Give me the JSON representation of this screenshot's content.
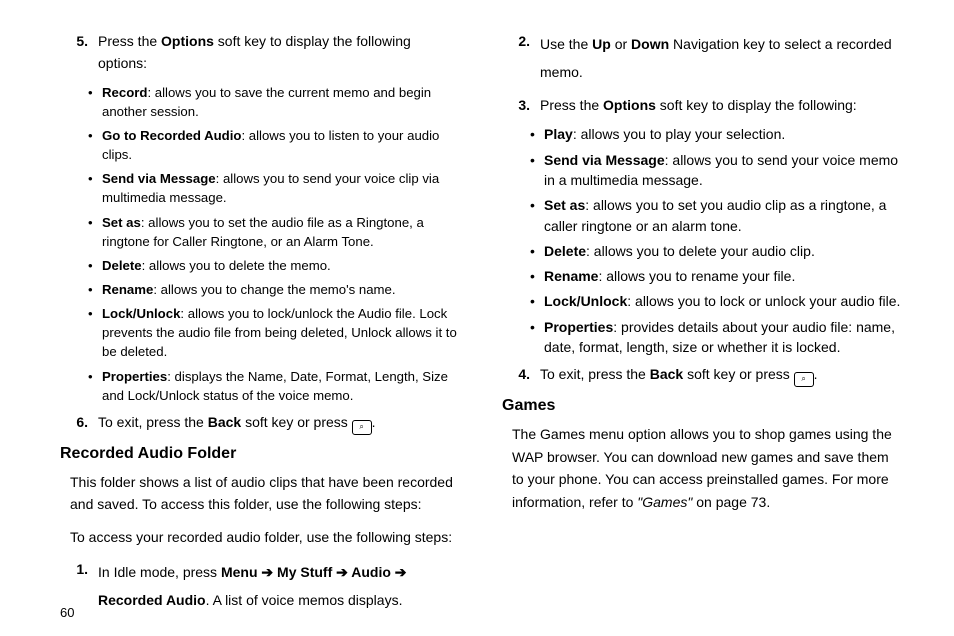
{
  "page_number": "60",
  "left": {
    "step5": {
      "num": "5.",
      "pre": "Press the ",
      "b1": "Options",
      "post": " soft key to display the following options:",
      "bullets": [
        {
          "b": "Record",
          "t": ": allows you to save the current memo and begin another session."
        },
        {
          "b": "Go to Recorded Audio",
          "t": ": allows you to listen to your audio clips."
        },
        {
          "b": "Send via Message",
          "t": ": allows you to send your voice clip via multimedia message."
        },
        {
          "b": "Set as",
          "t": ": allows you to set the audio file as a Ringtone, a ringtone for Caller Ringtone, or an Alarm Tone."
        },
        {
          "b": "Delete",
          "t": ": allows you to delete the memo."
        },
        {
          "b": "Rename",
          "t": ": allows you to change the memo's name."
        },
        {
          "b": "Lock/Unlock",
          "t": ": allows you to lock/unlock the Audio file. Lock prevents the audio file from being deleted, Unlock allows it to be deleted."
        },
        {
          "b": "Properties",
          "t": ": displays the Name, Date, Format, Length, Size and Lock/Unlock status of the voice memo."
        }
      ]
    },
    "step6": {
      "num": "6.",
      "pre": "To exit, press the ",
      "b1": "Back",
      "mid": " soft key or press ",
      "post": "."
    },
    "h_recorded": "Recorded Audio Folder",
    "para1": "This folder shows a list of audio clips that have been recorded and saved. To access this folder, use the following steps:",
    "para2": "To access your recorded audio folder, use the following steps:",
    "step1": {
      "num": "1.",
      "pre": "In Idle mode, press ",
      "b1": "Menu",
      "a1": " ➔ ",
      "b2": "My Stuff",
      "a2": " ➔ ",
      "b3": "Audio",
      "a3": " ➔ ",
      "b4": "Recorded Audio",
      "post": ". A list of voice memos displays."
    }
  },
  "right": {
    "step2": {
      "num": "2.",
      "pre": "Use the ",
      "b1": "Up",
      "mid1": " or ",
      "b2": "Down",
      "post": " Navigation key to select a recorded memo."
    },
    "step3": {
      "num": "3.",
      "pre": "Press the ",
      "b1": "Options",
      "post": " soft key to display the following:",
      "bullets": [
        {
          "b": "Play",
          "t": ": allows you to play your selection."
        },
        {
          "b": "Send via Message",
          "t": ": allows you to send your voice memo in a multimedia message."
        },
        {
          "b": "Set as",
          "t": ": allows you to set you audio clip as a ringtone, a caller ringtone or an alarm tone."
        },
        {
          "b": "Delete",
          "t": ": allows you to delete your audio clip."
        },
        {
          "b": "Rename",
          "t": ": allows you to rename your file."
        },
        {
          "b": "Lock/Unlock",
          "t": ": allows you to lock or unlock your audio file."
        },
        {
          "b": "Properties",
          "t": ": provides details about your audio file: name, date, format, length, size or whether it is locked."
        }
      ]
    },
    "step4": {
      "num": "4.",
      "pre": "To exit, press the ",
      "b1": "Back",
      "mid": " soft key or press ",
      "post": "."
    },
    "h_games": "Games",
    "games_pre": "The Games menu option allows you to shop games using the WAP browser. You can download new games and save them to your phone. You can access preinstalled games. For more information, refer to ",
    "games_ref": "\"Games\"",
    "games_post": "  on page 73."
  }
}
